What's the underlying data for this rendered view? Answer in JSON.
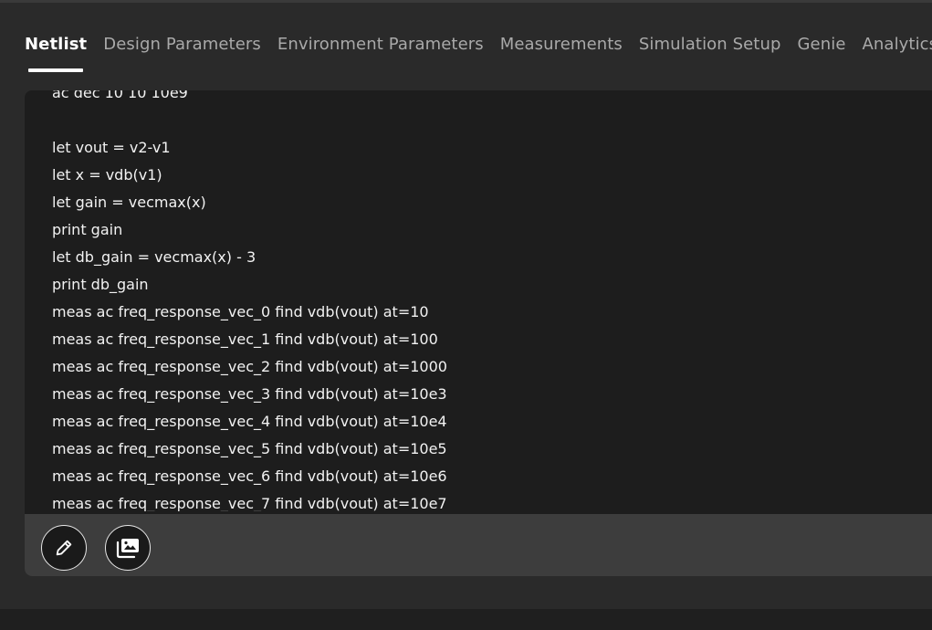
{
  "tabs": [
    {
      "label": "Netlist",
      "active": true
    },
    {
      "label": "Design Parameters",
      "active": false
    },
    {
      "label": "Environment Parameters",
      "active": false
    },
    {
      "label": "Measurements",
      "active": false
    },
    {
      "label": "Simulation Setup",
      "active": false
    },
    {
      "label": "Genie",
      "active": false
    },
    {
      "label": "Analytics",
      "active": false
    }
  ],
  "netlist": {
    "lines": [
      "ac dec 10 10 10e9",
      "",
      "let vout = v2-v1",
      "let x = vdb(v1)",
      "let gain = vecmax(x)",
      "print gain",
      "let db_gain = vecmax(x) - 3",
      "print db_gain",
      "meas ac freq_response_vec_0 find vdb(vout) at=10",
      "meas ac freq_response_vec_1 find vdb(vout) at=100",
      "meas ac freq_response_vec_2 find vdb(vout) at=1000",
      "meas ac freq_response_vec_3 find vdb(vout) at=10e3",
      "meas ac freq_response_vec_4 find vdb(vout) at=10e4",
      "meas ac freq_response_vec_5 find vdb(vout) at=10e5",
      "meas ac freq_response_vec_6 find vdb(vout) at=10e6",
      "meas ac freq_response_vec_7 find vdb(vout) at=10e7"
    ]
  },
  "toolbar": {
    "buttons": [
      {
        "name": "edit-button",
        "icon": "pencil-icon"
      },
      {
        "name": "gallery-button",
        "icon": "image-gallery-icon"
      }
    ]
  },
  "colors": {
    "background": "#2a2a2a",
    "panel": "#1d1d1d",
    "toolbar": "#3d3d3d",
    "active_tab": "#ffffff",
    "inactive_tab": "#a9a9a9"
  }
}
